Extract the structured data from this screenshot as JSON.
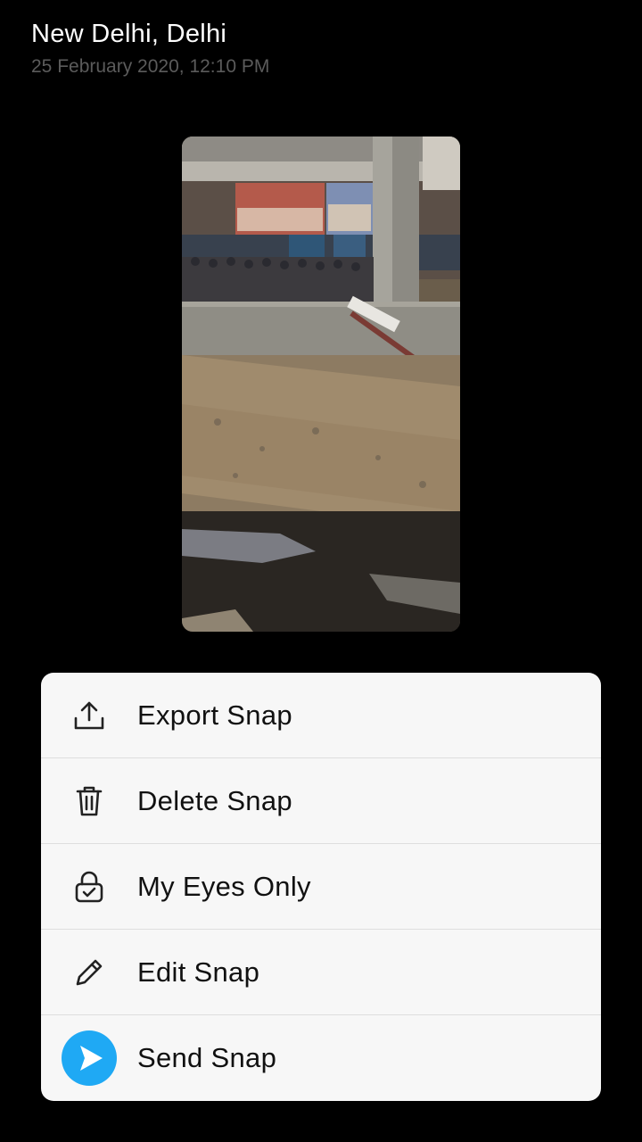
{
  "header": {
    "location": "New Delhi, Delhi",
    "timestamp": "25 February 2020, 12:10 PM"
  },
  "snap": {
    "alt": "Photo of a crowd on a street near a metro pillar and a dry canal"
  },
  "actions": [
    {
      "label": "Export Snap",
      "icon": "export-icon"
    },
    {
      "label": "Delete Snap",
      "icon": "trash-icon"
    },
    {
      "label": "My Eyes Only",
      "icon": "lock-icon"
    },
    {
      "label": "Edit Snap",
      "icon": "pencil-icon"
    },
    {
      "label": "Send Snap",
      "icon": "send-icon"
    }
  ],
  "colors": {
    "background": "#000000",
    "sheet": "#f7f7f7",
    "send_accent": "#1fa9f4",
    "timestamp": "#5b5b5b"
  }
}
